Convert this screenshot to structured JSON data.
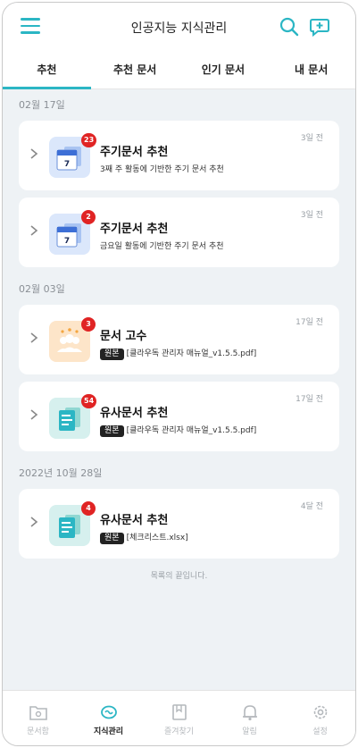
{
  "header": {
    "title": "인공지능 지식관리"
  },
  "tabs": [
    {
      "label": "추천"
    },
    {
      "label": "추천 문서"
    },
    {
      "label": "인기 문서"
    },
    {
      "label": "내 문서"
    }
  ],
  "groups": [
    {
      "date": "02월 17일",
      "cards": [
        {
          "title": "주기문서 추천",
          "subtitle": "3째 주 활동에 기반한 주기 문서 추천",
          "time": "3일 전",
          "badge": "23"
        },
        {
          "title": "주기문서 추천",
          "subtitle": "금요일 활동에 기반한 주기 문서 추천",
          "time": "3일 전",
          "badge": "2"
        }
      ]
    },
    {
      "date": "02월 03일",
      "cards": [
        {
          "title": "문서 고수",
          "tag": "원본",
          "file": "[클라우독 관리자 매뉴얼_v1.5.5.pdf]",
          "time": "17일 전",
          "badge": "3"
        },
        {
          "title": "유사문서 추천",
          "tag": "원본",
          "file": "[클라우독 관리자 매뉴얼_v1.5.5.pdf]",
          "time": "17일 전",
          "badge": "54"
        }
      ]
    },
    {
      "date": "2022년 10월 28일",
      "cards": [
        {
          "title": "유사문서 추천",
          "tag": "원본",
          "file": "[체크리스트.xlsx]",
          "time": "4달 전",
          "badge": "4"
        }
      ]
    }
  ],
  "end_text": "목록의 끝입니다.",
  "bottom_nav": [
    {
      "label": "문서함",
      "icon": "folder-icon"
    },
    {
      "label": "지식관리",
      "icon": "brain-icon"
    },
    {
      "label": "즐겨찾기",
      "icon": "bookmark-icon"
    },
    {
      "label": "알림",
      "icon": "bell-icon"
    },
    {
      "label": "설정",
      "icon": "settings-icon"
    }
  ],
  "colors": {
    "accent": "#2bb6c4",
    "badge": "#e02424",
    "background": "#eef2f5"
  }
}
